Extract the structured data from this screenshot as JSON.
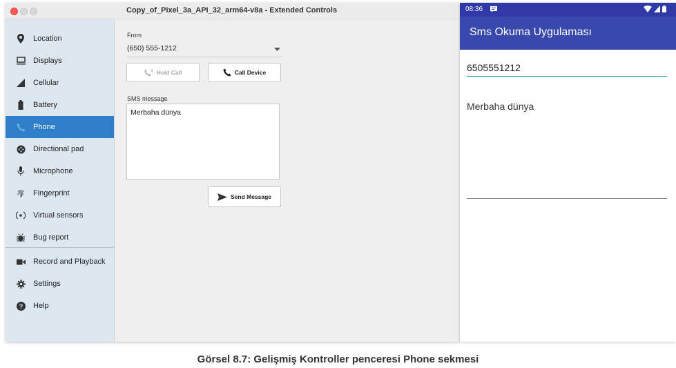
{
  "window": {
    "title": "Copy_of_Pixel_3a_API_32_arm64-v8a - Extended Controls"
  },
  "sidebar": {
    "items": [
      {
        "label": "Location",
        "icon": "location-pin-icon"
      },
      {
        "label": "Displays",
        "icon": "display-icon"
      },
      {
        "label": "Cellular",
        "icon": "cellular-signal-icon"
      },
      {
        "label": "Battery",
        "icon": "battery-icon"
      },
      {
        "label": "Phone",
        "icon": "phone-icon"
      },
      {
        "label": "Directional pad",
        "icon": "dpad-icon"
      },
      {
        "label": "Microphone",
        "icon": "microphone-icon"
      },
      {
        "label": "Fingerprint",
        "icon": "fingerprint-icon"
      },
      {
        "label": "Virtual sensors",
        "icon": "virtual-sensors-icon"
      },
      {
        "label": "Bug report",
        "icon": "bug-icon"
      },
      {
        "label": "Record and Playback",
        "icon": "video-camera-icon"
      },
      {
        "label": "Settings",
        "icon": "gear-icon"
      },
      {
        "label": "Help",
        "icon": "help-icon"
      }
    ],
    "active": "Phone"
  },
  "phone_panel": {
    "from_label": "From",
    "from_value": "(650) 555-1212",
    "hold_call_label": "Hold Call",
    "call_device_label": "Call Device",
    "sms_label": "SMS message",
    "sms_text": "Merbaha dünya",
    "send_label": "Send Message"
  },
  "device": {
    "status_time": "08:36",
    "app_title": "Sms Okuma Uygulaması",
    "phone_number": "6505551212",
    "message": "Merbaha dünya"
  },
  "caption": "Görsel 8.7: Gelişmiş Kontroller penceresi Phone sekmesi",
  "colors": {
    "accent": "#2c7fc8",
    "appbar": "#3949ab",
    "statusbar": "#2f3aa8",
    "input_underline": "#26a69a",
    "close_button": "#fd5c56"
  }
}
